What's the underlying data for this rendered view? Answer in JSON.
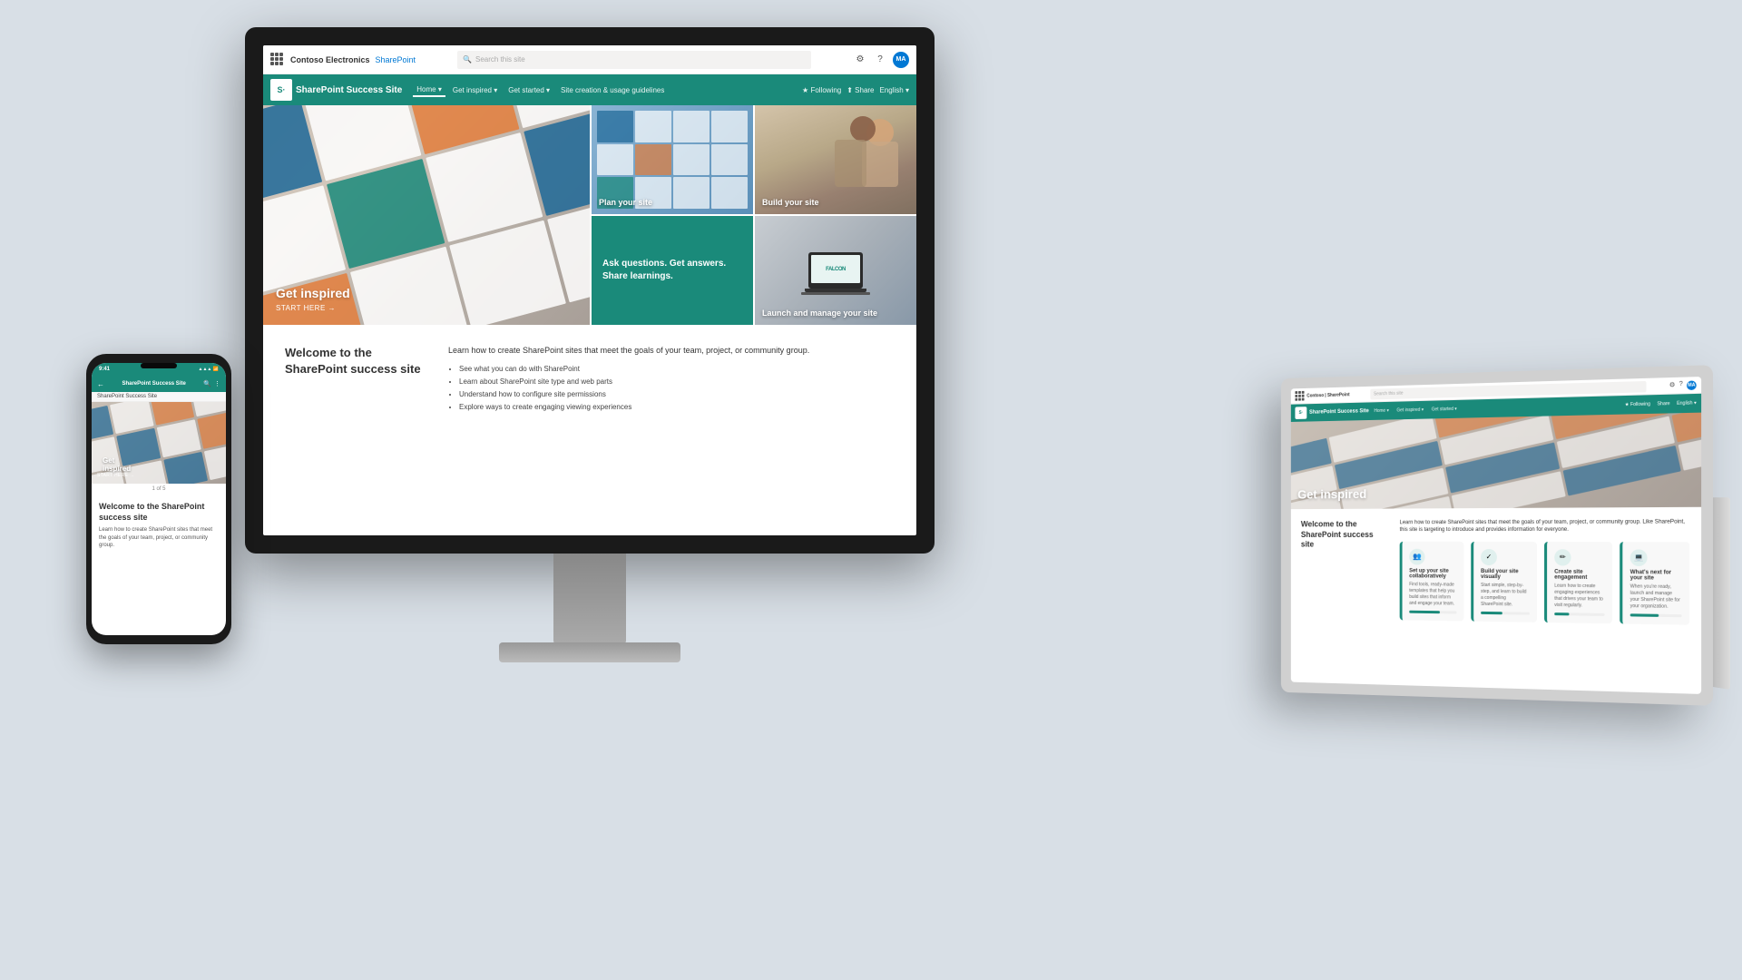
{
  "page": {
    "background_color": "#d8dfe6"
  },
  "monitor": {
    "topbar": {
      "waffle_label": "apps",
      "company_name": "Contoso Electronics",
      "app_name": "SharePoint",
      "search_placeholder": "Search this site",
      "settings_icon": "⚙",
      "help_icon": "?",
      "user_initials": "MA"
    },
    "navbar": {
      "site_icon_text": "S·",
      "site_title": "SharePoint Success Site",
      "nav_links": [
        {
          "label": "Home",
          "has_dropdown": true
        },
        {
          "label": "Get inspired",
          "has_dropdown": true
        },
        {
          "label": "Get started",
          "has_dropdown": true
        },
        {
          "label": "Site creation & usage guidelines"
        }
      ],
      "following_label": "★ Following",
      "share_label": "⬆ Share",
      "language_label": "English",
      "language_dropdown": true
    },
    "hero": {
      "main_title": "Get inspired",
      "main_cta": "START HERE →",
      "tiles": [
        {
          "id": "plan",
          "label": "Plan your site"
        },
        {
          "id": "build",
          "label": "Build your site"
        },
        {
          "id": "ask",
          "title": "Ask questions. Get answers. Share learnings."
        },
        {
          "id": "launch",
          "label": "Launch and manage your site"
        }
      ]
    },
    "welcome": {
      "title": "Welcome to the SharePoint success site",
      "intro": "Learn how to create SharePoint sites that meet the goals of your team, project, or community group.",
      "bullets": [
        "See what you can do with SharePoint",
        "Learn about SharePoint site type and web parts",
        "Understand how to configure site permissions",
        "Explore ways to create engaging viewing experiences"
      ]
    }
  },
  "phone": {
    "status_bar": {
      "time": "9:41",
      "signal": "▲▲▲ WiFi"
    },
    "nav_title": "SharePoint Success Site",
    "breadcrumb": "SharePoint Success Site",
    "hero_title": "Get inspired",
    "hero_cta": "START HERE →",
    "pagination": "1 of 5",
    "welcome_title": "Welcome to the SharePoint success site",
    "welcome_body": "Learn how to create SharePoint sites that meet the goals of your team, project, or community group."
  },
  "tablet": {
    "topbar": {
      "logo": "Contoso | SharePoint",
      "search_placeholder": "Search this site",
      "user_initials": "MA"
    },
    "navbar": {
      "site_icon": "S·",
      "site_title": "SharePoint Success Site",
      "nav_links": [
        "Home",
        "Get inspired",
        "Get started"
      ],
      "following": "★ Following",
      "share": "Share",
      "language": "English"
    },
    "hero_title": "Get inspired",
    "welcome": {
      "title": "Welcome to the SharePoint success site",
      "intro": "Learn how to create SharePoint sites that meet the goals of your team, project, or community group. Like SharePoint, this site is targeting to introduce and provides information for everyone.",
      "cards": [
        {
          "icon": "👥",
          "title": "Set up your site collaboratively",
          "body": "Find tools, ready-made templates that help you build sites that inform and engage your team.",
          "progress": 65
        },
        {
          "icon": "✓",
          "title": "Build your site visually",
          "body": "Start simple, step-by-step, and learn to build a compelling SharePoint site.",
          "progress": 45
        },
        {
          "icon": "✏",
          "title": "Create site engagement",
          "body": "Learn how to create engaging experiences that drives your team to visit regularly.",
          "progress": 30
        },
        {
          "icon": "💻",
          "title": "What's next for your site",
          "body": "When you're ready, launch and manage your SharePoint site for your organization.",
          "progress": 55
        }
      ]
    }
  }
}
